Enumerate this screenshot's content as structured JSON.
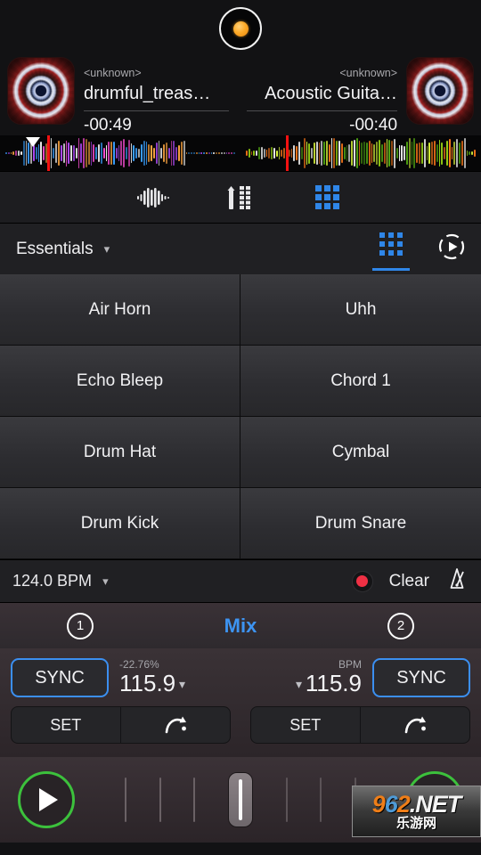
{
  "app": {
    "record_indicator": "vinyl-record-icon"
  },
  "decks": {
    "left": {
      "artist": "<unknown>",
      "title": "drumful_treas…",
      "time_remaining": "-00:49",
      "waveform_colors": [
        "#ff4fd8",
        "#b24cff",
        "#3aa0ff",
        "#ffa640",
        "#ffffff"
      ],
      "playhead_color": "#f31111",
      "sync_label": "SYNC",
      "pitch_percent": "-22.76%",
      "bpm_value": "115.9",
      "set_label": "SET",
      "cue_icon": "curved-arrow-icon",
      "play_icon": "play-icon",
      "deck_number": "1"
    },
    "right": {
      "artist": "<unknown>",
      "title": "Acoustic Guita…",
      "time_remaining": "-00:40",
      "waveform_colors": [
        "#9bd714",
        "#d8f53a",
        "#4fa513",
        "#ffffff",
        "#ff7a1a"
      ],
      "playhead_color": "#f31111",
      "sync_label": "SYNC",
      "bpm_caption": "BPM",
      "bpm_value": "115.9",
      "set_label": "SET",
      "cue_icon": "curved-arrow-icon",
      "play_icon": "play-icon",
      "deck_number": "2"
    }
  },
  "mode_toolbar": {
    "items": [
      {
        "icon": "waveform-icon",
        "active": false
      },
      {
        "icon": "mixer-fader-icon",
        "active": false
      },
      {
        "icon": "pad-grid-icon",
        "active": true
      }
    ],
    "active_color": "#2f86e8"
  },
  "bank": {
    "name": "Essentials",
    "caret_icon": "chevron-down-icon",
    "view_grid_icon": "pad-grid-icon",
    "view_loop_icon": "play-circle-icon",
    "active_tab": "grid"
  },
  "pads": [
    {
      "label": "Air Horn"
    },
    {
      "label": "Uhh"
    },
    {
      "label": "Echo Bleep"
    },
    {
      "label": "Chord 1"
    },
    {
      "label": "Drum Hat"
    },
    {
      "label": "Cymbal"
    },
    {
      "label": "Drum Kick"
    },
    {
      "label": "Drum Snare"
    }
  ],
  "bpm_bar": {
    "tempo": "124.0 BPM",
    "caret_icon": "chevron-down-icon",
    "record_icon": "record-dot-icon",
    "clear_label": "Clear",
    "metronome_icon": "metronome-muted-icon",
    "record_color": "#ef3044"
  },
  "mixer_tabs": {
    "left_deck": "1",
    "center_label": "Mix",
    "right_deck": "2",
    "center_color": "#3d94f2"
  },
  "crossfader": {
    "position": "center",
    "tick_count": 7
  },
  "watermark": {
    "digits_1": "9",
    "digits_2": "6",
    "digits_3": "2",
    "suffix": ".NET",
    "subtitle": "乐游网"
  }
}
